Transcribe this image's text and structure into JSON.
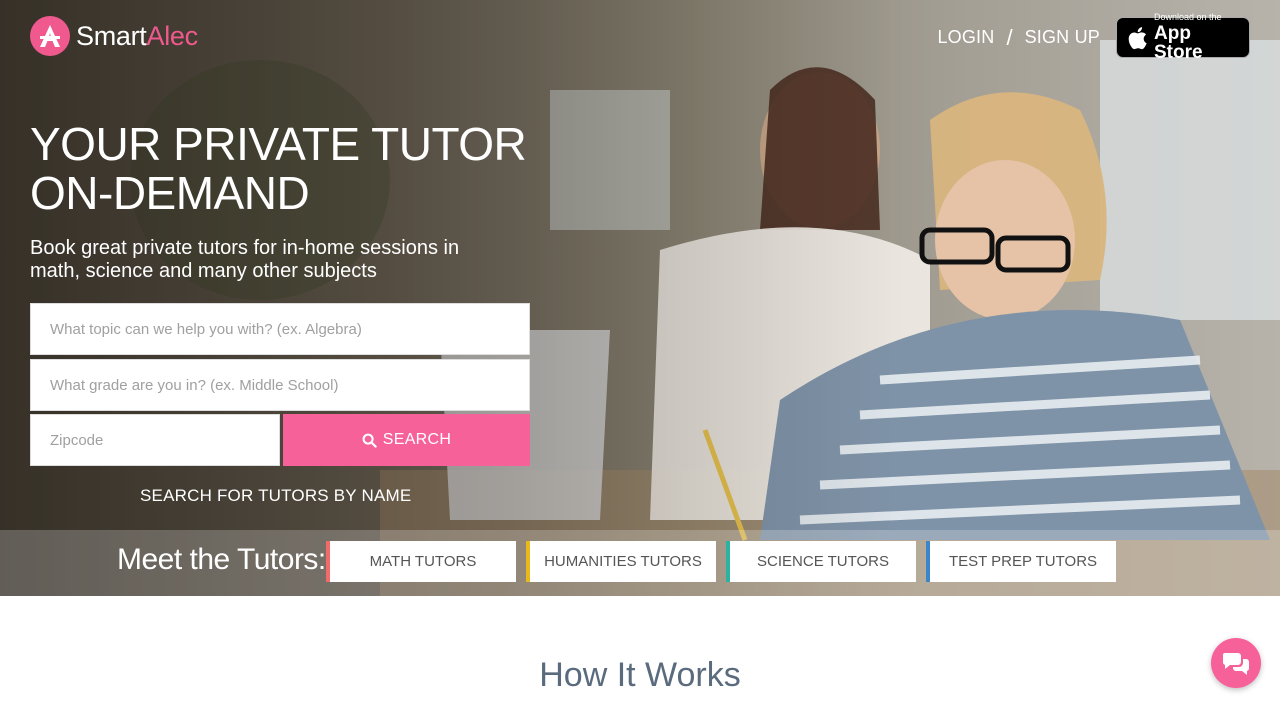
{
  "brand": {
    "name_part1": "Smart",
    "name_part2": "Alec",
    "color": "#f0598e"
  },
  "nav": {
    "login": "LOGIN",
    "separator": "/",
    "signup": "SIGN UP",
    "appstore_small": "Download on the",
    "appstore_big": "App Store"
  },
  "hero": {
    "headline_line1": "YOUR PRIVATE TUTOR",
    "headline_line2": "ON-DEMAND",
    "subhead": "Book great private tutors for in-home sessions in math, science and many other subjects"
  },
  "search": {
    "topic_placeholder": "What topic can we help you with? (ex. Algebra)",
    "grade_placeholder": "What grade are you in? (ex. Middle School)",
    "zip_placeholder": "Zipcode",
    "button_label": "SEARCH",
    "by_name_link": "SEARCH FOR TUTORS BY NAME",
    "button_color": "#f7619a"
  },
  "meet": {
    "label": "Meet the Tutors:",
    "buttons": [
      {
        "label": "MATH TUTORS",
        "color": "#f26b6b"
      },
      {
        "label": "HUMANITIES TUTORS",
        "color": "#e8b91b"
      },
      {
        "label": "SCIENCE TUTORS",
        "color": "#2bb3a0"
      },
      {
        "label": "TEST PREP TUTORS",
        "color": "#3a86c8"
      }
    ]
  },
  "how_it_works": {
    "title": "How It Works"
  },
  "icons": {
    "logo": "smartalec-logo-icon",
    "apple": "apple-icon",
    "search": "search-icon",
    "chat": "chat-icon"
  }
}
